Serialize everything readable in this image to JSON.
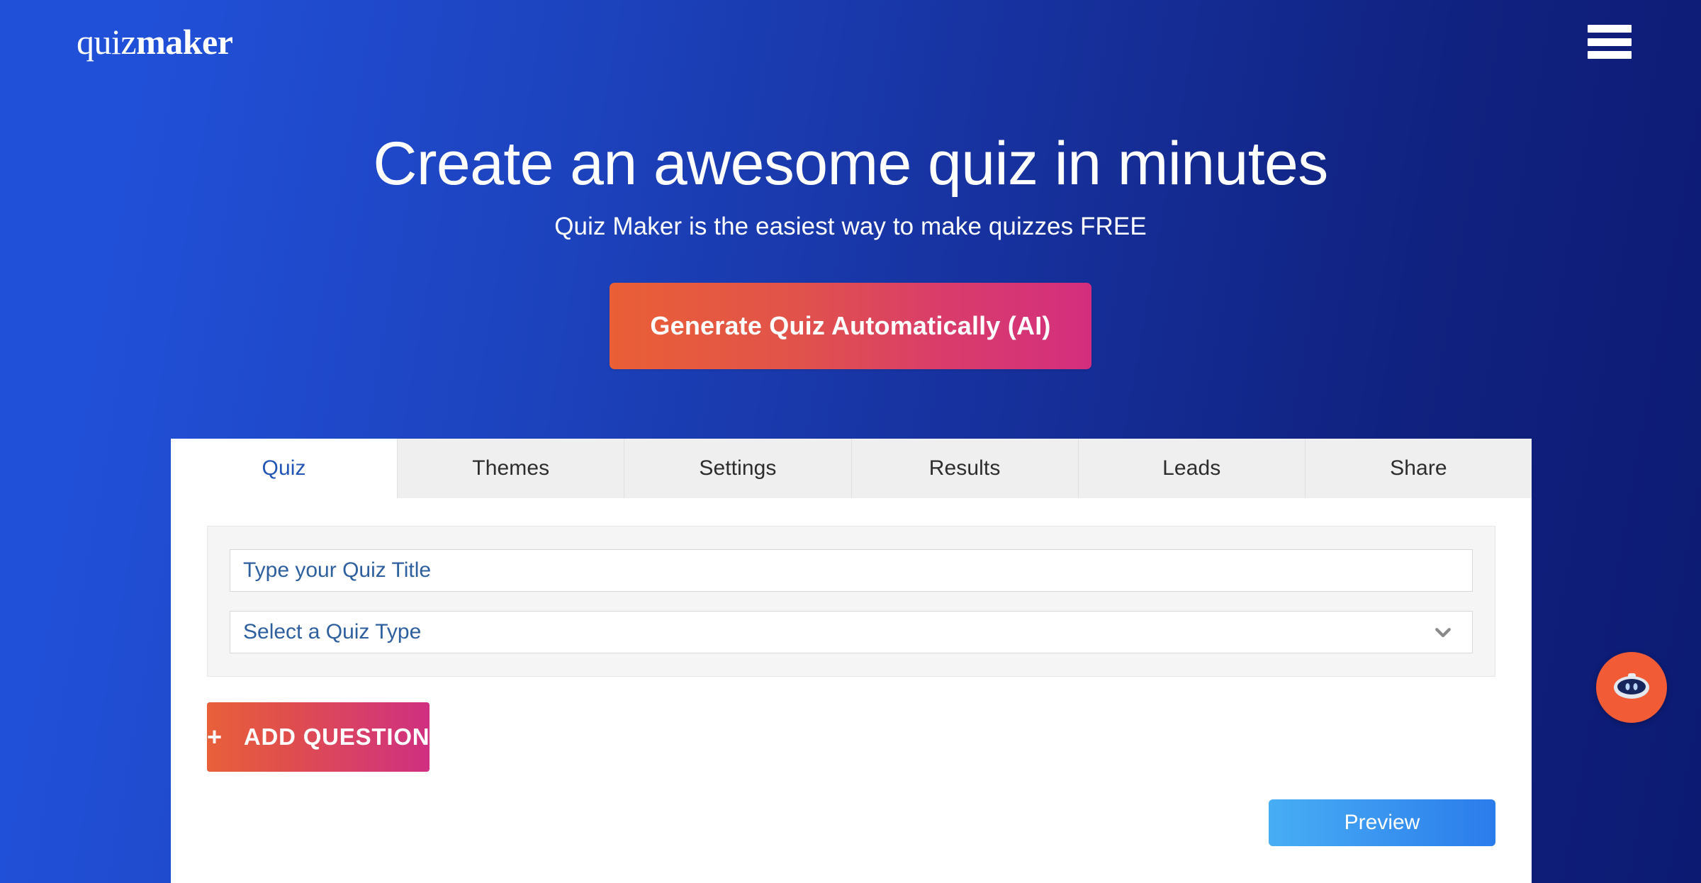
{
  "header": {
    "logo_light": "quiz",
    "logo_bold": "maker",
    "menu_icon": "hamburger-menu-icon"
  },
  "hero": {
    "title": "Create an awesome quiz in minutes",
    "subtitle": "Quiz Maker is the easiest way to make quizzes FREE",
    "cta_label": "Generate Quiz Automatically (AI)"
  },
  "builder": {
    "tabs": [
      {
        "label": "Quiz",
        "active": true
      },
      {
        "label": "Themes",
        "active": false
      },
      {
        "label": "Settings",
        "active": false
      },
      {
        "label": "Results",
        "active": false
      },
      {
        "label": "Leads",
        "active": false
      },
      {
        "label": "Share",
        "active": false
      }
    ],
    "title_input": {
      "value": "",
      "placeholder": "Type your Quiz Title"
    },
    "type_select": {
      "selected": "Select a Quiz Type",
      "chevron_icon": "chevron-down-icon"
    },
    "add_question_label": "ADD QUESTION",
    "add_question_plus": "+",
    "preview_label": "Preview"
  },
  "chat_widget": {
    "icon": "robot-chat-icon"
  },
  "colors": {
    "bg_left": "#2150d8",
    "bg_right": "#0c1a72",
    "accent_orange": "#ea5f36",
    "accent_pink": "#d32e7e",
    "tab_active_text": "#2255b5",
    "input_text": "#2e5f9e",
    "preview_blue": "#2b7ceb",
    "widget_orange": "#f15b35"
  }
}
